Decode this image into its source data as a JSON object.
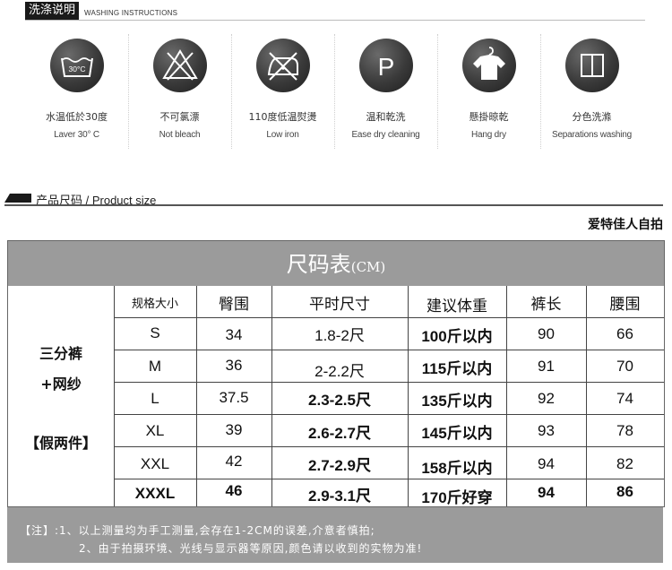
{
  "washing": {
    "tag_cn": "洗涤说明",
    "tag_en": "WASHING INSTRUCTIONS",
    "items": [
      {
        "icon": "wash-30-icon",
        "badge": "30°C",
        "cn": "水温低於30度",
        "en": "Laver 30° C"
      },
      {
        "icon": "no-bleach-icon",
        "cn": "不可氯漂",
        "en": "Not bleach"
      },
      {
        "icon": "low-iron-icon",
        "cn": "110度低温熨燙",
        "en": "Low iron"
      },
      {
        "icon": "dry-clean-icon",
        "badge": "P",
        "cn": "温和乾洗",
        "en": "Ease dry cleaning"
      },
      {
        "icon": "hang-dry-icon",
        "cn": "懸掛晾乾",
        "en": "Hang dry"
      },
      {
        "icon": "separate-wash-icon",
        "cn": "分色洗滌",
        "en": "Separations washing"
      }
    ]
  },
  "size_section": {
    "heading": "产品尺码 / Product size",
    "brand": "爱特佳人自拍"
  },
  "size_table": {
    "title": "尺码表",
    "unit": "(CM)",
    "product_lines": [
      "三分裤",
      "+网纱",
      "【假两件】"
    ],
    "headers": [
      "规格大小",
      "臀围",
      "平时尺寸",
      "建议体重",
      "裤长",
      "腰围"
    ],
    "rows": [
      [
        "S",
        "34",
        "1.8-2尺",
        "100斤以内",
        "90",
        "66"
      ],
      [
        "M",
        "36",
        "2-2.2尺",
        "115斤以内",
        "91",
        "70"
      ],
      [
        "L",
        "37.5",
        "2.3-2.5尺",
        "135斤以内",
        "92",
        "74"
      ],
      [
        "XL",
        "39",
        "2.6-2.7尺",
        "145斤以内",
        "93",
        "78"
      ],
      [
        "XXL",
        "42",
        "2.7-2.9尺",
        "158斤以内",
        "94",
        "82"
      ],
      [
        "XXXL",
        "46",
        "2.9-3.1尺",
        "170斤好穿",
        "94",
        "86"
      ]
    ]
  },
  "notes": {
    "line1": "【注】:1、以上测量均为手工测量,会存在1-2CM的误差,介意者慎拍;",
    "line2": "2、由于拍摄环境、光线与显示器等原因,颜色请以收到的实物为准!"
  },
  "colors": {
    "header_gray": "#9b9b9b",
    "icon_dark": "#2e2e2e",
    "text_dark": "#111111"
  }
}
